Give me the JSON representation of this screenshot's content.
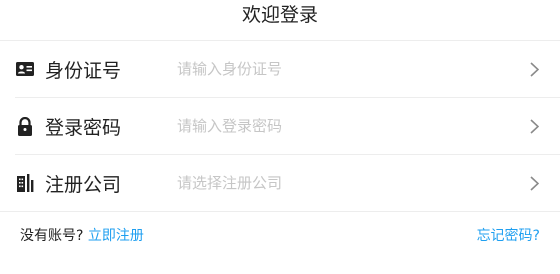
{
  "header": {
    "title": "欢迎登录"
  },
  "form": {
    "rows": [
      {
        "icon": "id-card-icon",
        "label": "身份证号",
        "placeholder": "请输入身份证号",
        "value": ""
      },
      {
        "icon": "lock-icon",
        "label": "登录密码",
        "placeholder": "请输入登录密码",
        "value": ""
      },
      {
        "icon": "building-icon",
        "label": "注册公司",
        "placeholder": "请选择注册公司",
        "value": ""
      }
    ]
  },
  "footer": {
    "no_account_text": "没有账号?",
    "register_link": "立即注册",
    "forgot_password_link": "忘记密码?"
  },
  "colors": {
    "link": "#1f9ff0",
    "placeholder": "#c6c6c6",
    "divider": "#ededed",
    "text": "#222222"
  }
}
